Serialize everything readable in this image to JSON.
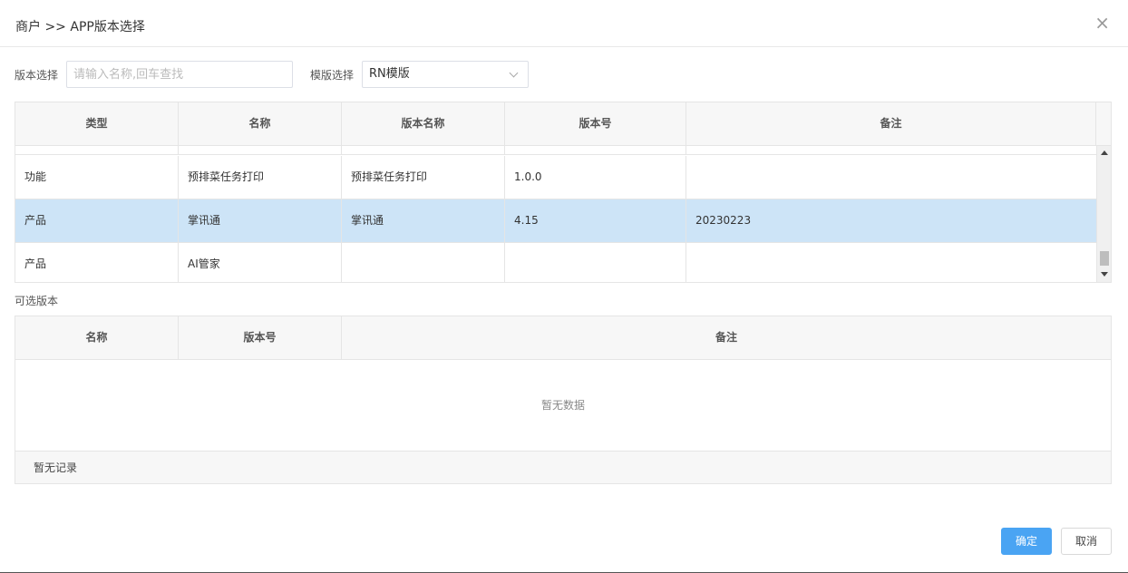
{
  "dialog": {
    "title": "商户 >> APP版本选择",
    "close_symbol": "×"
  },
  "filters": {
    "version_label": "版本选择",
    "search_placeholder": "请输入名称,回车查找",
    "template_label": "模版选择",
    "template_selected": "RN模版"
  },
  "table1": {
    "columns": [
      "类型",
      "名称",
      "版本名称",
      "版本号",
      "备注"
    ],
    "rows": [
      {
        "type": "功能",
        "name": "预排菜任务打印",
        "version_name": "预排菜任务打印",
        "version_no": "1.0.0",
        "remark": "",
        "selected": false
      },
      {
        "type": "产品",
        "name": "掌讯通",
        "version_name": "掌讯通",
        "version_no": "4.15",
        "remark": "20230223",
        "selected": true
      },
      {
        "type": "产品",
        "name": "AI管家",
        "version_name": "",
        "version_no": "",
        "remark": "",
        "selected": false
      }
    ]
  },
  "optional": {
    "section_label": "可选版本",
    "columns": [
      "名称",
      "版本号",
      "备注"
    ],
    "empty_text": "暂无数据",
    "footer_text": "暂无记录"
  },
  "buttons": {
    "ok_label": "确定",
    "cancel_label": "取消"
  },
  "colors": {
    "primary": "#4aa4f3",
    "selected_row": "#cde4f7"
  }
}
